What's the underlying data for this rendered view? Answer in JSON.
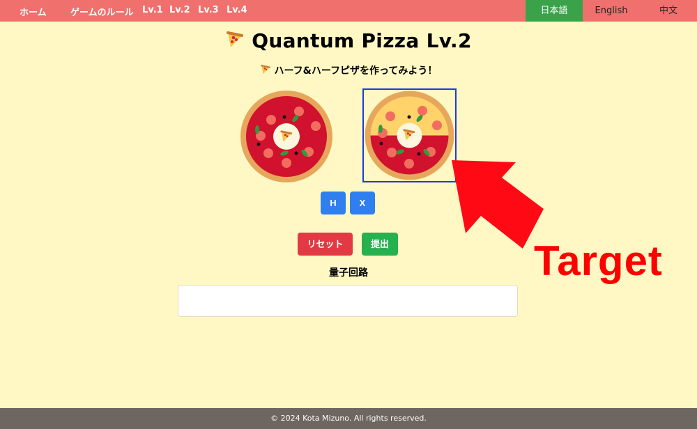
{
  "nav": {
    "home": "ホーム",
    "rules": "ゲームのルール",
    "lv1": "Lv.1",
    "lv2": "Lv.2",
    "lv3": "Lv.3",
    "lv4": "Lv.4",
    "lang_ja": "日本語",
    "lang_en": "English",
    "lang_zh": "中文"
  },
  "title": "Quantum Pizza Lv.2",
  "subtitle": "ハーフ&ハーフピザを作ってみよう！",
  "gates": {
    "h": "H",
    "x": "X"
  },
  "actions": {
    "reset": "リセット",
    "submit": "提出"
  },
  "circuit_label": "量子回路",
  "annotation": "Target",
  "footer": "© 2024 Kota Mizuno. All rights reserved.",
  "colors": {
    "nav_bg": "#f0706e",
    "page_bg": "#fff8c4",
    "active_lang": "#3aa34a",
    "gate_button": "#2f7ff0",
    "reset_button": "#e23a45",
    "submit_button": "#26b04e",
    "annotation": "#ff0000"
  },
  "icons": [
    "pizza-slice-icon",
    "tomato-pizza-icon",
    "half-and-half-pizza-icon",
    "arrow-icon"
  ]
}
